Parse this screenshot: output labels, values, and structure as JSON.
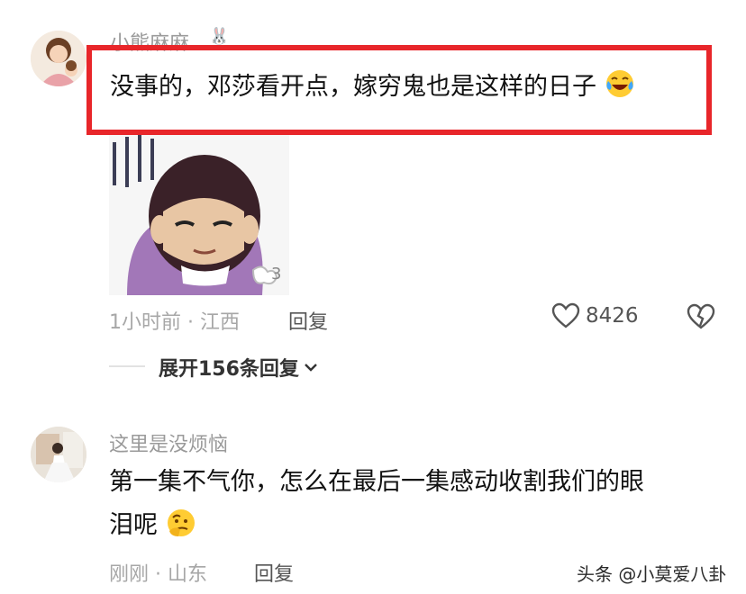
{
  "comments": [
    {
      "username": "小熊麻麻",
      "text": "没事的，邓莎看开点，嫁穷鬼也是这样的日子",
      "emoji": "laughing-crying-emoji",
      "has_sticker": true,
      "time": "1小时前",
      "location": "江西",
      "reply_label": "回复",
      "likes": "8426",
      "expand_label": "展开156条回复"
    },
    {
      "username": "这里是没烦恼",
      "text_line1": "第一集不气你，怎么在最后一集感动收割我们的眼",
      "text_line2": "泪呢",
      "emoji": "thinking-emoji",
      "time": "刚刚",
      "location": "山东",
      "reply_label": "回复"
    }
  ],
  "meta_separator": "·",
  "watermark": "头条 @小莫爱八卦",
  "colors": {
    "highlight": "#e8262a",
    "meta": "#a7a7a7"
  }
}
